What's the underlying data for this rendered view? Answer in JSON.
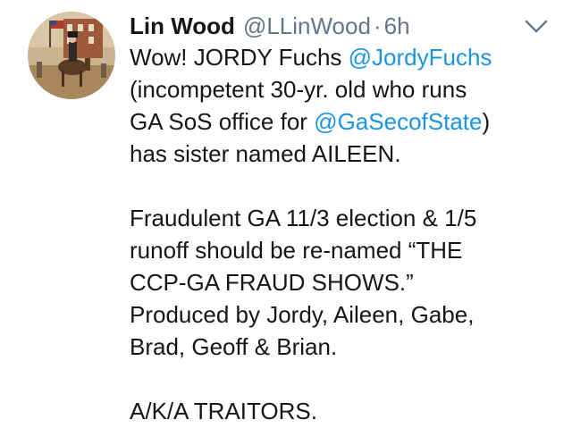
{
  "tweet": {
    "author_name": "Lin Wood",
    "author_handle": "@LLinWood",
    "separator": "·",
    "time": "6h",
    "avatar_icon": "painting-avatar-icon",
    "caret_icon": "chevron-down-icon",
    "paragraph1": {
      "line1_prefix": "Wow! JORDY Fuchs ",
      "mention1": "@JordyFuchs",
      "line2": "(incompetent 30-yr. old who runs",
      "line3_prefix": "GA SoS office for ",
      "mention2": "@GaSecofState",
      "line3_suffix": ")",
      "line4": "has sister named AILEEN."
    },
    "paragraph2": {
      "line1": "Fraudulent GA 11/3 election & 1/5",
      "line2": "runoff should be re-named “THE",
      "line3": "CCP-GA FRAUD SHOWS.”",
      "line4": "Produced by Jordy, Aileen, Gabe,",
      "line5": "Brad, Geoff & Brian."
    },
    "paragraph3": {
      "line1": "A/K/A TRAITORS."
    }
  },
  "colors": {
    "text": "#14171a",
    "secondary": "#657786",
    "link": "#1b95e0",
    "background": "#ffffff"
  }
}
